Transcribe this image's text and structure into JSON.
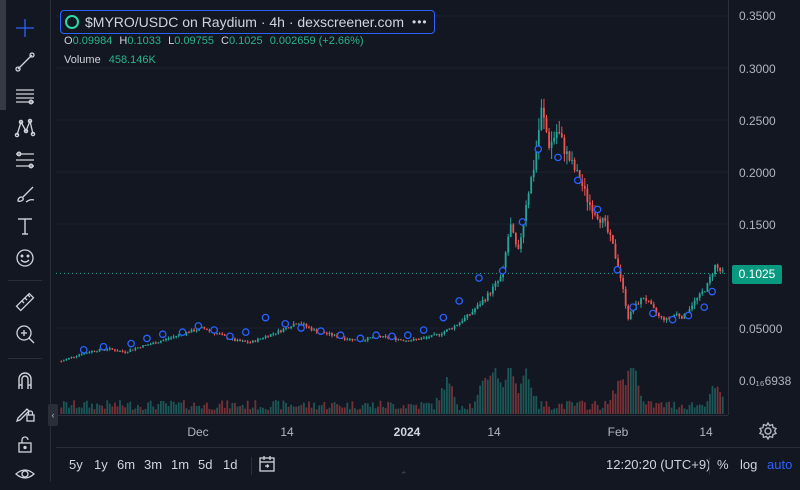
{
  "legend": {
    "title": "$MYRO/USDC on Raydium · 4h · dexscreener.com",
    "ohlc": [
      {
        "key": "O",
        "value": "0.09984"
      },
      {
        "key": "H",
        "value": "0.1033"
      },
      {
        "key": "L",
        "value": "0.09755"
      },
      {
        "key": "C",
        "value": "0.1025"
      },
      {
        "key": "",
        "value": "0.002659 (+2.66%)"
      }
    ],
    "volume_label": "Volume",
    "volume_value": "458.146K"
  },
  "price_axis": {
    "ticks": [
      "0.3500",
      "0.3000",
      "0.2500",
      "0.2000",
      "0.1500",
      "0.05000"
    ],
    "bottom_label": "0.0₁₆6938",
    "last_price": "0.1025",
    "last_price_color": "#089981"
  },
  "time_axis": {
    "ticks": [
      {
        "label": "Dec",
        "bold": false
      },
      {
        "label": "14",
        "bold": false
      },
      {
        "label": "2024",
        "bold": true
      },
      {
        "label": "14",
        "bold": false
      },
      {
        "label": "Feb",
        "bold": false
      },
      {
        "label": "14",
        "bold": false
      }
    ]
  },
  "bottom_bar": {
    "ranges": [
      "5y",
      "1y",
      "6m",
      "3m",
      "1m",
      "5d",
      "1d"
    ],
    "clock": "12:20:20 (UTC+9)",
    "percent": "%",
    "log": "log",
    "auto": "auto"
  },
  "toolbar": {
    "tools": [
      "crosshair-icon",
      "trend-line-icon",
      "horizontal-lines-icon",
      "pattern-icon",
      "fib-tool-icon",
      "brush-icon",
      "text-tool-icon",
      "emoji-icon",
      "ruler-icon",
      "zoom-in-icon",
      "magnet-icon",
      "lock-draw-icon",
      "lock-icon",
      "eye-icon"
    ]
  },
  "colors": {
    "background": "#131722",
    "up": "#26a69a",
    "down": "#ef5350",
    "accent": "#2962ff",
    "marker": "#2962ff"
  },
  "chart_data": {
    "type": "candlestick",
    "title": "$MYRO/USDC on Raydium · 4h · dexscreener.com",
    "ylim": [
      0,
      0.35
    ],
    "y_ticks": [
      0.05,
      0.15,
      0.2,
      0.25,
      0.3,
      0.35
    ],
    "last_price": 0.1025,
    "x_ticks": [
      "Dec",
      "14",
      "2024",
      "14",
      "Feb",
      "14"
    ],
    "price_path": [
      [
        0,
        0.018
      ],
      [
        4,
        0.024
      ],
      [
        8,
        0.028
      ],
      [
        12,
        0.03
      ],
      [
        16,
        0.027
      ],
      [
        20,
        0.032
      ],
      [
        24,
        0.036
      ],
      [
        28,
        0.041
      ],
      [
        32,
        0.046
      ],
      [
        36,
        0.05
      ],
      [
        40,
        0.044
      ],
      [
        44,
        0.038
      ],
      [
        48,
        0.036
      ],
      [
        52,
        0.042
      ],
      [
        56,
        0.048
      ],
      [
        60,
        0.056
      ],
      [
        64,
        0.048
      ],
      [
        68,
        0.044
      ],
      [
        72,
        0.04
      ],
      [
        76,
        0.038
      ],
      [
        80,
        0.042
      ],
      [
        84,
        0.04
      ],
      [
        88,
        0.038
      ],
      [
        92,
        0.04
      ],
      [
        96,
        0.044
      ],
      [
        100,
        0.052
      ],
      [
        104,
        0.064
      ],
      [
        108,
        0.08
      ],
      [
        112,
        0.1
      ],
      [
        114,
        0.15
      ],
      [
        116,
        0.12
      ],
      [
        118,
        0.17
      ],
      [
        120,
        0.205
      ],
      [
        122,
        0.26
      ],
      [
        124,
        0.225
      ],
      [
        126,
        0.24
      ],
      [
        128,
        0.22
      ],
      [
        130,
        0.205
      ],
      [
        132,
        0.19
      ],
      [
        134,
        0.17
      ],
      [
        136,
        0.16
      ],
      [
        138,
        0.15
      ],
      [
        140,
        0.13
      ],
      [
        142,
        0.1
      ],
      [
        144,
        0.06
      ],
      [
        146,
        0.072
      ],
      [
        148,
        0.08
      ],
      [
        150,
        0.07
      ],
      [
        152,
        0.06
      ],
      [
        154,
        0.058
      ],
      [
        156,
        0.064
      ],
      [
        158,
        0.06
      ],
      [
        160,
        0.072
      ],
      [
        162,
        0.08
      ],
      [
        164,
        0.09
      ],
      [
        166,
        0.11
      ],
      [
        168,
        0.1025
      ]
    ],
    "volume_peaks": [
      {
        "i": 98,
        "v": 0.55
      },
      {
        "i": 108,
        "v": 0.7
      },
      {
        "i": 110,
        "v": 0.9
      },
      {
        "i": 114,
        "v": 1.0
      },
      {
        "i": 118,
        "v": 0.8
      },
      {
        "i": 142,
        "v": 0.6
      },
      {
        "i": 145,
        "v": 1.1
      },
      {
        "i": 166,
        "v": 0.4
      }
    ],
    "markers": [
      [
        6,
        0.029
      ],
      [
        11,
        0.032
      ],
      [
        18,
        0.035
      ],
      [
        22,
        0.04
      ],
      [
        26,
        0.044
      ],
      [
        31,
        0.046
      ],
      [
        35,
        0.052
      ],
      [
        39,
        0.048
      ],
      [
        43,
        0.042
      ],
      [
        47,
        0.046
      ],
      [
        52,
        0.06
      ],
      [
        57,
        0.054
      ],
      [
        61,
        0.05
      ],
      [
        66,
        0.047
      ],
      [
        71,
        0.043
      ],
      [
        76,
        0.04
      ],
      [
        80,
        0.043
      ],
      [
        84,
        0.042
      ],
      [
        88,
        0.043
      ],
      [
        92,
        0.048
      ],
      [
        97,
        0.06
      ],
      [
        101,
        0.076
      ],
      [
        106,
        0.098
      ],
      [
        112,
        0.105
      ],
      [
        117,
        0.152
      ],
      [
        121,
        0.222
      ],
      [
        126,
        0.214
      ],
      [
        131,
        0.192
      ],
      [
        136,
        0.164
      ],
      [
        141,
        0.106
      ],
      [
        145,
        0.07
      ],
      [
        150,
        0.064
      ],
      [
        155,
        0.058
      ],
      [
        159,
        0.062
      ],
      [
        163,
        0.07
      ],
      [
        165,
        0.085
      ]
    ]
  }
}
